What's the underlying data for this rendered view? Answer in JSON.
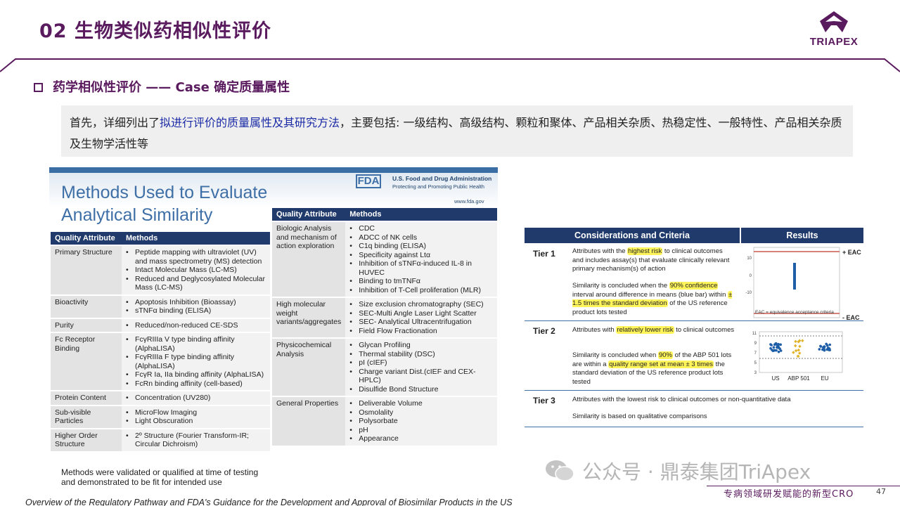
{
  "title": "02 生物类似药相似性评价",
  "logo": {
    "text": "TRIAPEX"
  },
  "section": {
    "heading": "药学相似性评价 —— Case 确定质量属性"
  },
  "intro": {
    "prefix": "首先，详细列出了",
    "highlight": "拟进行评价的质量属性及其研究方法",
    "suffix": "，主要包括: 一级结构、高级结构、颗粒和聚体、产品相关杂质、热稳定性、一般特性、产品相关杂质及生物学活性等"
  },
  "fda": {
    "title": "Methods Used to Evaluate Analytical Similarity",
    "logo": "FDA",
    "org": "U.S. Food and Drug Administration",
    "tagline": "Protecting and Promoting Public Health",
    "url": "www.fda.gov",
    "col_attr": "Quality Attribute",
    "col_methods": "Methods",
    "left_rows": [
      {
        "attr": "Primary Structure",
        "methods": [
          "Peptide mapping with ultraviolet (UV) and mass spectrometry (MS) detection",
          "Intact Molecular Mass (LC-MS)",
          "Reduced and Deglycosylated Molecular Mass (LC-MS)"
        ]
      },
      {
        "attr": "Bioactivity",
        "methods": [
          "Apoptosis Inhibition (Bioassay)",
          "sTNFα binding (ELISA)"
        ]
      },
      {
        "attr": "Purity",
        "methods": [
          "Reduced/non-reduced CE-SDS"
        ]
      },
      {
        "attr": "Fc Receptor Binding",
        "methods": [
          "FcγRIIIa V type binding affinity (AlphaLISA)",
          "FcγRIIIa F type binding affinity (AlphaLISA)",
          "FcγR Ia, IIa binding affinity (AlphaLISA)",
          "FcRn binding affinity (cell-based)"
        ]
      },
      {
        "attr": "Protein Content",
        "methods": [
          "Concentration (UV280)"
        ]
      },
      {
        "attr": "Sub-visible Particles",
        "methods": [
          "MicroFlow Imaging",
          "Light Obscuration"
        ]
      },
      {
        "attr": "Higher Order Structure",
        "methods": [
          "2º Structure (Fourier Transform-IR; Circular Dichroism)"
        ]
      }
    ],
    "right_rows": [
      {
        "attr": "Biologic Analysis and mechanism of action exploration",
        "methods": [
          "CDC",
          "ADCC of NK cells",
          "C1q binding (ELISA)",
          "Specificity against Ltα",
          "Inhibition of sTNFα-induced IL-8 in HUVEC",
          "Binding to tmTNFα",
          "Inhibition of T-Cell proliferation (MLR)"
        ]
      },
      {
        "attr": "High molecular weight variants/aggregates",
        "methods": [
          "Size exclusion chromatography (SEC)",
          "SEC-Multi Angle Laser Light Scatter",
          "SEC- Analytical Ultracentrifugation",
          "Field Flow Fractionation"
        ]
      },
      {
        "attr": "Physicochemical Analysis",
        "methods": [
          "Glycan Profiling",
          "Thermal stability (DSC)",
          "pI (cIEF)",
          "Charge variant Dist.(cIEF and CEX-HPLC)",
          "Disulfide Bond Structure"
        ]
      },
      {
        "attr": "General Properties",
        "methods": [
          "Deliverable Volume",
          "Osmolality",
          "Polysorbate",
          "pH",
          "Appearance"
        ]
      }
    ],
    "note": "Methods were validated or qualified at time of testing and demonstrated to be fit for intended use"
  },
  "criteria": {
    "col_considerations": "Considerations and Criteria",
    "col_results": "Results",
    "tier1": {
      "label": "Tier 1",
      "a1": "Attributes with the ",
      "a_hl": "highest risk",
      "a2": " to clinical outcomes and includes assay(s) that evaluate clinically relevant primary mechanism(s) of action",
      "b1": "Similarity is concluded when the ",
      "b_hl": "90% confidence",
      "b2": " interval around difference in means (blue bar) within ",
      "b_hl2": "± 1.5 times the standard deviation",
      "b3": " of the US reference product lots tested",
      "eac_top": "+ EAC",
      "eac_bottom": "- EAC",
      "ticks": [
        "10",
        "0",
        "-10"
      ],
      "caption": "EAC = equivalence acceptance criteria"
    },
    "tier2": {
      "label": "Tier 2",
      "a1": "Attributes with ",
      "a_hl": "relatively lower risk",
      "a2": " to clinical outcomes",
      "b1": "Similarity is concluded when ",
      "b_hl": "90%",
      "b2": " of the ABP 501 lots are within a ",
      "b_hl2": "quality range set at mean ± 3 times",
      "b3": " the standard deviation of the US reference product lots tested",
      "ticks": [
        "11",
        "9",
        "7",
        "5",
        "3"
      ],
      "groups": [
        "US",
        "ABP 501",
        "EU"
      ]
    },
    "tier3": {
      "label": "Tier 3",
      "a": "Attributes with the lowest risk to clinical outcomes or non-quantitative data",
      "b": "Similarity is based on qualitative comparisons"
    }
  },
  "colors": {
    "brand": "#5a1a5e",
    "fda_blue": "#1f3a6b",
    "highlight": "#fff45a"
  },
  "watermark": "公众号 · 鼎泰集团TriApex",
  "footer": {
    "tagline": "专病领域研发赋能的新型CRO",
    "page": "47"
  },
  "source": "Overview of the Regulatory Pathway and FDA's Guidance for the Development and Approval of Biosimilar Products in the US"
}
